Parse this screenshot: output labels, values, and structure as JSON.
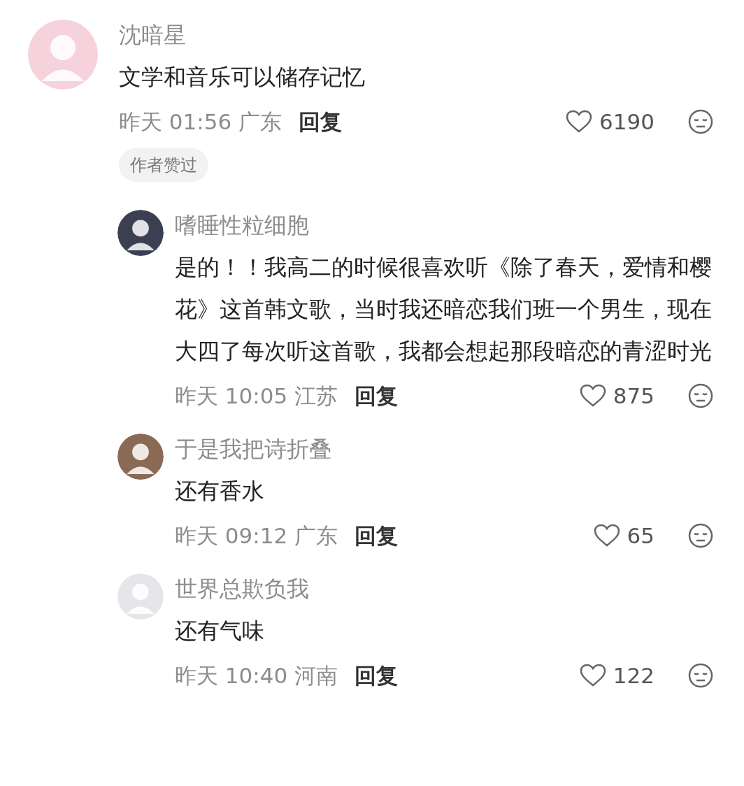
{
  "comments": [
    {
      "color": "#f6d3dc",
      "author": "沈暗星",
      "text": "文学和音乐可以储存记忆",
      "time": "昨天 01:56 广东",
      "reply_label": "回复",
      "likes": "6190",
      "badge": "作者赞过",
      "replies": [
        {
          "color": "#3b3f52",
          "author": "嗜睡性粒细胞",
          "text": "是的！！我高二的时候很喜欢听《除了春天，爱情和樱花》这首韩文歌，当时我还暗恋我们班一个男生，现在大四了每次听这首歌，我都会想起那段暗恋的青涩时光",
          "time": "昨天 10:05 江苏",
          "reply_label": "回复",
          "likes": "875"
        },
        {
          "color": "#8a6a55",
          "author": "于是我把诗折叠",
          "text": "还有香水",
          "time": "昨天 09:12 广东",
          "reply_label": "回复",
          "likes": "65"
        },
        {
          "color": "#e6e6ea",
          "author": "世界总欺负我",
          "text": "还有气味",
          "time": "昨天 10:40 河南",
          "reply_label": "回复",
          "likes": "122"
        }
      ]
    }
  ]
}
